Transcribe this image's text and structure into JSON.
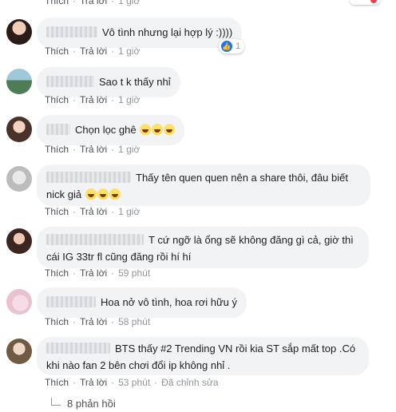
{
  "labels": {
    "like": "Thích",
    "reply": "Trả lời",
    "dot": "·",
    "edited": "Đã chỉnh sửa"
  },
  "top_time": "1 giờ",
  "comments": [
    {
      "text": "Vô tình nhưng lại hợp lý :))))",
      "time": "1 giờ",
      "reactions": "1"
    },
    {
      "text": "Sao t k thấy nhỉ",
      "time": "1 giờ"
    },
    {
      "text": "Chọn lọc ghê",
      "time": "1 giờ"
    },
    {
      "text": "Thấy tên quen quen nên a share thôi, đâu biết nick giả",
      "time": "1 giờ"
    },
    {
      "text": "T cứ ngỡ là ổng sẽ không đăng gì cả, giờ thì cái IG 33tr fl cũng đăng rồi hí hí",
      "time": "59 phút"
    },
    {
      "text": "Hoa nở vô tình, hoa rơi hữu ý",
      "time": "58 phút"
    },
    {
      "text": "BTS thấy #2 Trending VN rồi kia ST sắp mất top .Có khi nào fan 2 bên chơi đổi ip không nhỉ .",
      "time": "53 phút"
    }
  ],
  "more_replies": "8 phản hồi",
  "colors": {
    "link": "#4b4f56",
    "meta": "#90949c",
    "bubble": "#f2f3f5",
    "like_blue": "#1877f2"
  }
}
